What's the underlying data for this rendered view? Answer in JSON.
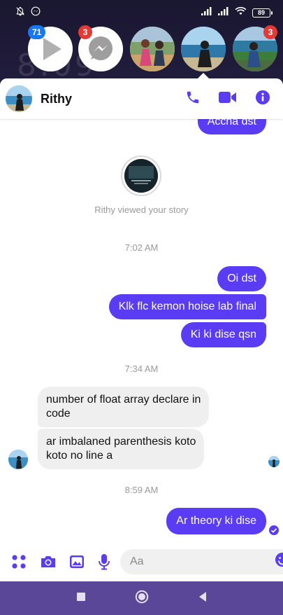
{
  "status_bar": {
    "left_icons": [
      "notifications-muted-icon",
      "messenger-notification-icon"
    ],
    "right_icons": [
      "signal-icon",
      "signal-icon",
      "wifi-icon"
    ],
    "battery": "89"
  },
  "chat_heads": [
    {
      "icon": "video-play-icon",
      "badge": "71",
      "badge_color": "#1877f2"
    },
    {
      "icon": "messenger-icon",
      "badge": "3",
      "badge_color": "#e53935"
    },
    {
      "icon": "contact-photo",
      "badge": ""
    },
    {
      "icon": "contact-photo",
      "badge": "",
      "active": true
    },
    {
      "icon": "contact-photo",
      "badge": "3",
      "badge_color": "#e53935"
    }
  ],
  "header": {
    "name": "Rithy",
    "accent": "#5b3cf5"
  },
  "messages": {
    "top_partial": "Accha dst",
    "story_text": "Rithy viewed your story",
    "time_1": "7:02 AM",
    "out_1": "Oi dst",
    "out_2": "Klk flc kemon hoise lab final",
    "out_3": "Ki ki dise qsn",
    "time_2": "7:34 AM",
    "in_1_line1": "number of float array declare in",
    "in_1_line2": "code",
    "in_2_line1": "ar imbalaned parenthesis koto",
    "in_2_line2": "koto no line a",
    "time_3": "8:59 AM",
    "out_4": "Ar theory ki dise"
  },
  "composer": {
    "placeholder": "Aa",
    "value": ""
  },
  "nav": {
    "buttons": [
      "recents-button",
      "home-button",
      "back-button"
    ]
  }
}
